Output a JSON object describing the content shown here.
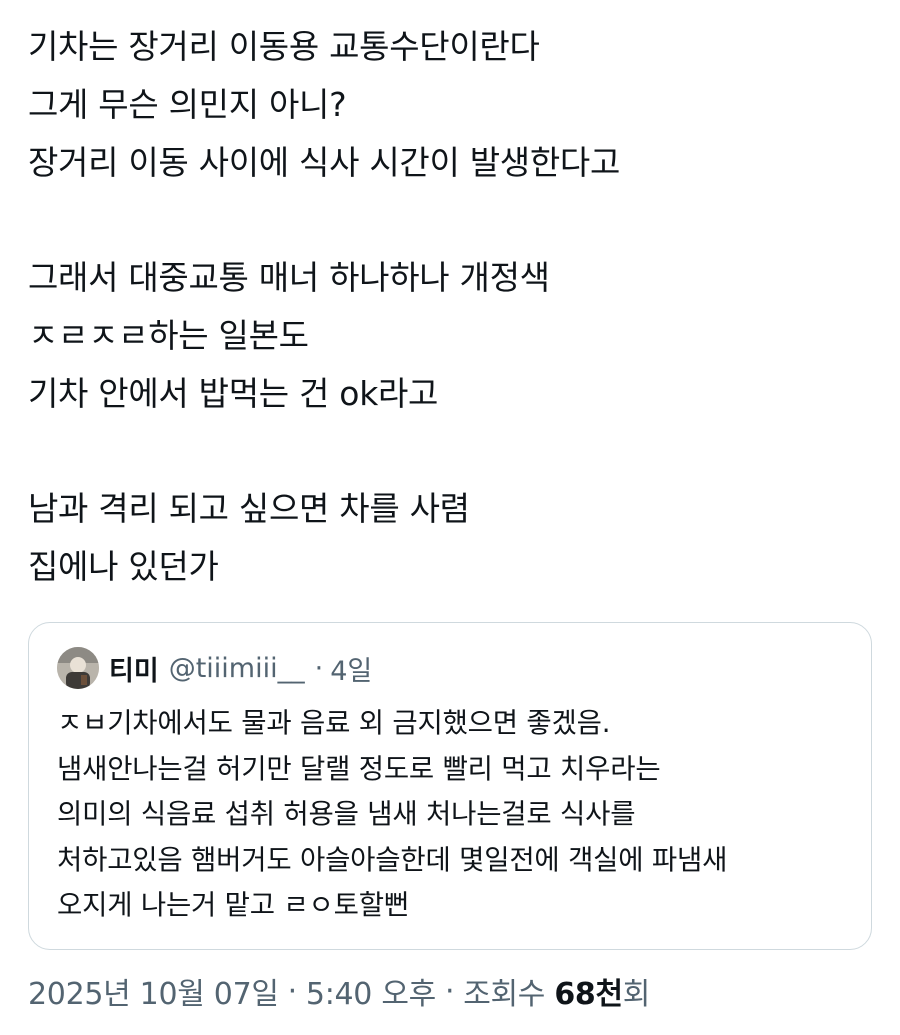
{
  "tweet": {
    "paragraphs": [
      [
        "기차는 장거리 이동용 교통수단이란다",
        "그게 무슨 의민지 아니?",
        "장거리 이동 사이에 식사 시간이 발생한다고"
      ],
      [
        "그래서 대중교통 매너 하나하나 개정색",
        "ㅈㄹㅈㄹ하는 일본도",
        "기차 안에서 밥먹는 건 ok라고"
      ],
      [
        "남과 격리 되고 싶으면 차를 사렴",
        "집에나 있던가"
      ]
    ]
  },
  "quote": {
    "avatar_icon": "user-avatar-photo",
    "name": "티미",
    "handle": "@tiiimiii__",
    "separator": "·",
    "age": "4일",
    "lines": [
      "ㅈㅂ기차에서도 물과 음료 외 금지했으면 좋겠음.",
      "냄새안나는걸 허기만 달랠 정도로 빨리 먹고 치우라는",
      "의미의 식음료 섭취 허용을 냄새 처나는걸로 식사를",
      "처하고있음 햄버거도 아슬아슬한데 몇일전에 객실에 파냄새",
      "오지게 나는거 맡고 ㄹㅇ토할뻔"
    ]
  },
  "meta": {
    "date": "2025년 10월 07일",
    "separator": "·",
    "time": "5:40 오후",
    "views_label": "조회수",
    "views_count": "68천",
    "views_suffix": "회"
  },
  "colors": {
    "text": "#0f1419",
    "secondary": "#536471",
    "border": "#cfd9de"
  }
}
